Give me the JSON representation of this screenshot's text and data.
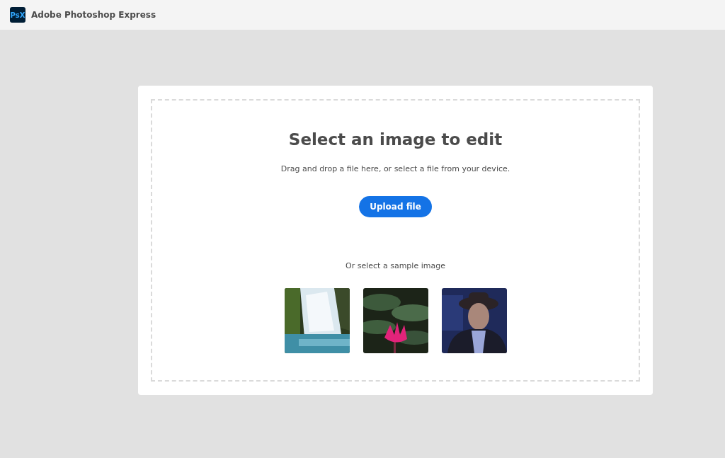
{
  "header": {
    "logo": "PsX",
    "title": "Adobe Photoshop Express"
  },
  "upload": {
    "title": "Select an image to edit",
    "subtitle": "Drag and drop a file here, or select a file from your device.",
    "button": "Upload file"
  },
  "samples": {
    "label": "Or select a sample image"
  }
}
